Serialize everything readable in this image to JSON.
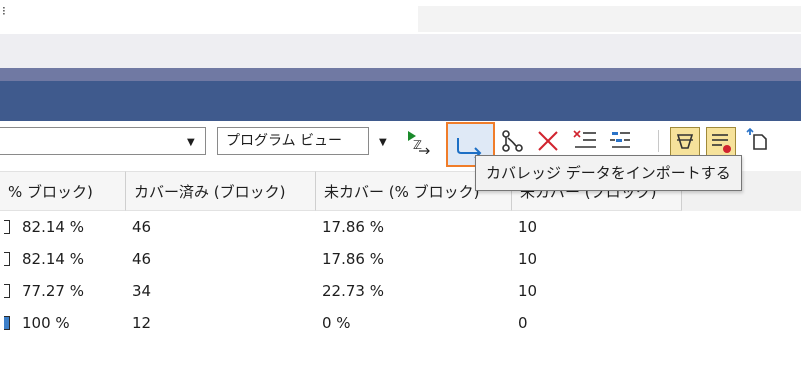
{
  "top": {
    "glyph": "⁝"
  },
  "toolbar": {
    "view_combo": "プログラム ビュー",
    "tooltip": "カバレッジ データをインポートする",
    "icons": {
      "run": "run-coverage-icon",
      "import": "import-coverage-icon",
      "merge": "merge-results-icon",
      "delete": "delete-icon",
      "remove_all": "remove-all-icon",
      "settings": "settings-icon",
      "highlight": "highlight-icon",
      "columns": "add-remove-columns-icon",
      "export": "export-icon"
    }
  },
  "table": {
    "headers": [
      "% ブロック)",
      "カバー済み (ブロック)",
      "未カバー (% ブロック)",
      "未カバー (ブロック)"
    ],
    "rows": [
      {
        "covered_pct": "82.14 %",
        "covered_blocks": "46",
        "uncovered_pct": "17.86 %",
        "uncovered_blocks": "10"
      },
      {
        "covered_pct": "82.14 %",
        "covered_blocks": "46",
        "uncovered_pct": "17.86 %",
        "uncovered_blocks": "10"
      },
      {
        "covered_pct": "77.27 %",
        "covered_blocks": "34",
        "uncovered_pct": "22.73 %",
        "uncovered_blocks": "10"
      },
      {
        "covered_pct": "100 %",
        "covered_blocks": "12",
        "uncovered_pct": "0 %",
        "uncovered_blocks": "0"
      }
    ]
  },
  "colors": {
    "title_bar": "#3f5a8d",
    "highlight_orange": "#f07d2a",
    "full_coverage_blue": "#3c7fc9"
  }
}
